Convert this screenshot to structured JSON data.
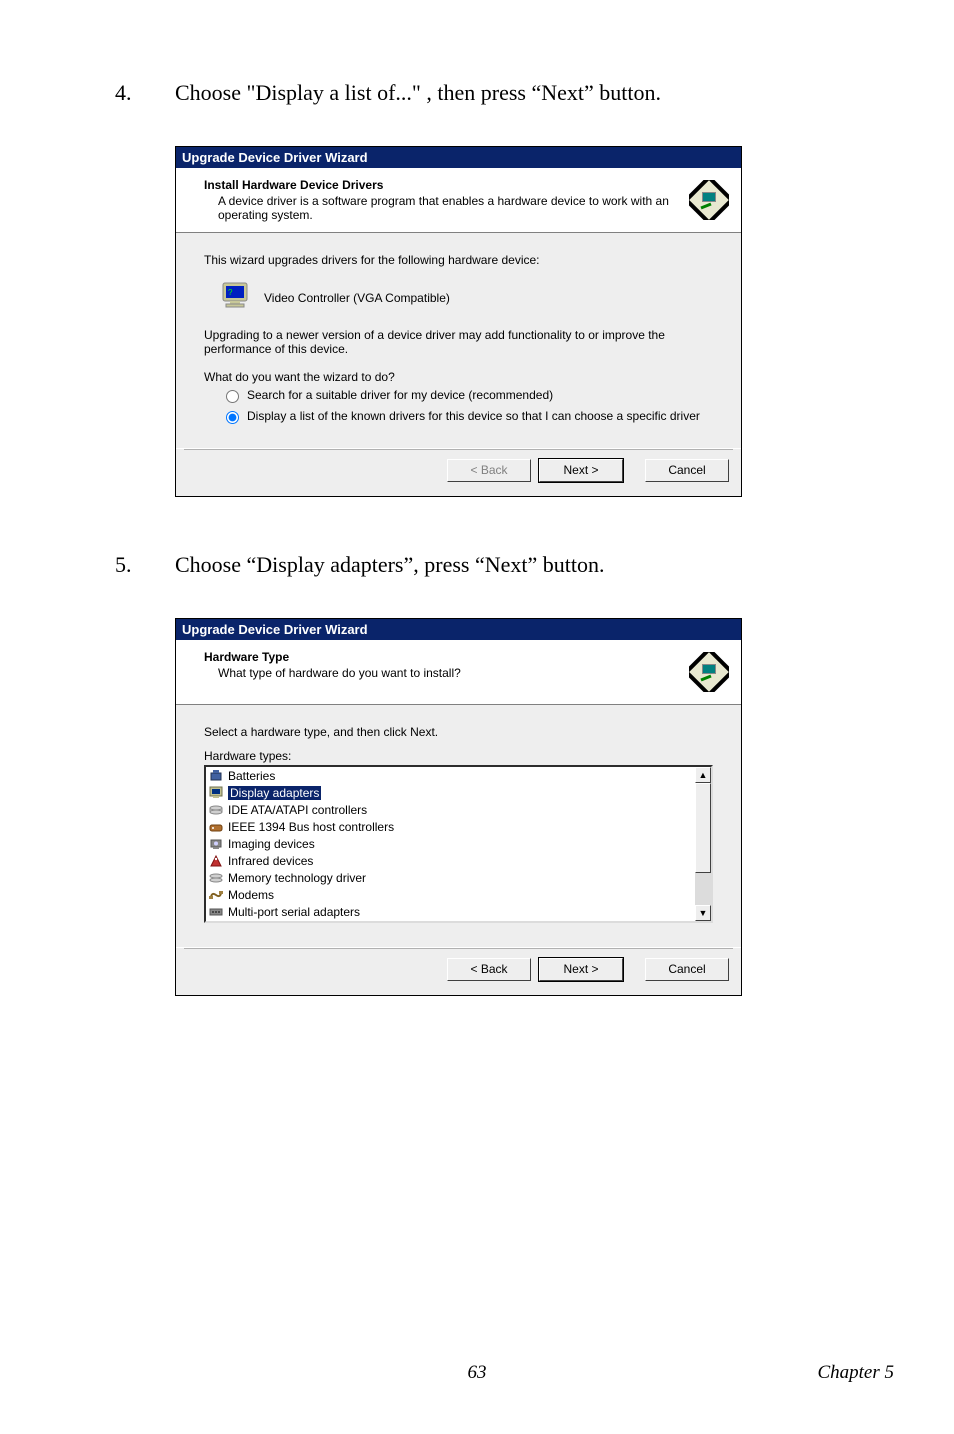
{
  "step4": {
    "num": "4.",
    "text": "Choose \"Display a list of...\" , then press “Next” button."
  },
  "step5": {
    "num": "5.",
    "text": "Choose “Display adapters”, press “Next” button."
  },
  "dialog1": {
    "title": "Upgrade Device Driver Wizard",
    "header_title": "Install Hardware Device Drivers",
    "header_sub": "A device driver is a software program that enables a hardware device to work with an operating system.",
    "line1": "This wizard upgrades drivers for the following hardware device:",
    "device": "Video Controller (VGA Compatible)",
    "line2": "Upgrading to a newer version of a device driver may add functionality to or improve the performance of this device.",
    "line3": "What do you want the wizard to do?",
    "opt1": "Search for a suitable driver for my device (recommended)",
    "opt2": "Display a list of the known drivers for this device so that I can choose a specific driver",
    "back": "< Back",
    "next": "Next >",
    "cancel": "Cancel"
  },
  "dialog2": {
    "title": "Upgrade Device Driver Wizard",
    "header_title": "Hardware Type",
    "header_sub": "What type of hardware do you want to install?",
    "instr": "Select a hardware type, and then click Next.",
    "label": "Hardware types:",
    "items": [
      "Batteries",
      "Display adapters",
      "IDE ATA/ATAPI controllers",
      "IEEE 1394 Bus host controllers",
      "Imaging devices",
      "Infrared devices",
      "Memory technology driver",
      "Modems",
      "Multi-port serial adapters"
    ],
    "selected_index": 1,
    "back": "< Back",
    "next": "Next >",
    "cancel": "Cancel"
  },
  "footer": {
    "page": "63",
    "chapter": "Chapter 5"
  }
}
